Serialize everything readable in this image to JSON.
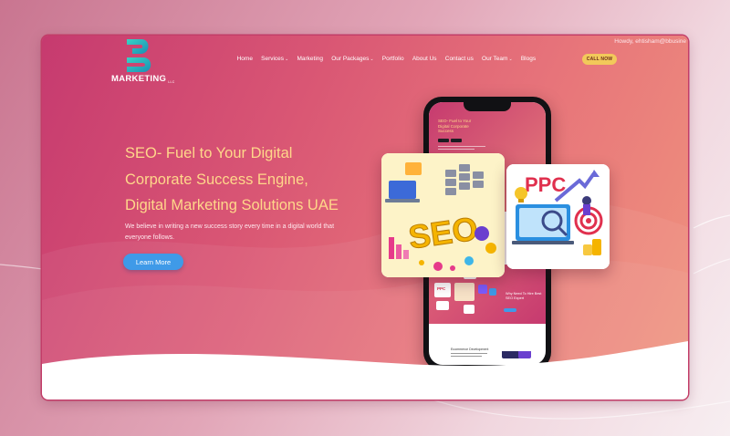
{
  "header": {
    "howdy": "Howdy, ehtisham@bbusine",
    "logo_text": "MARKETING",
    "logo_suffix": "LLC",
    "nav": [
      {
        "label": "Home",
        "dropdown": false
      },
      {
        "label": "Services",
        "dropdown": true
      },
      {
        "label": "Marketing",
        "dropdown": false
      },
      {
        "label": "Our Packages",
        "dropdown": true
      },
      {
        "label": "Portfolio",
        "dropdown": false
      },
      {
        "label": "About Us",
        "dropdown": false
      },
      {
        "label": "Contact us",
        "dropdown": false
      },
      {
        "label": "Our Team",
        "dropdown": true
      },
      {
        "label": "Blogs",
        "dropdown": false
      }
    ],
    "call_button": "CALL NOW"
  },
  "hero": {
    "title_lines": [
      "SEO- Fuel to Your Digital",
      "Corporate Success Engine,",
      "Digital Marketing Solutions UAE"
    ],
    "description_lines": [
      "We believe in writing a new success story every time in a digital world that",
      "everyone follows."
    ],
    "learn_more": "Learn More"
  },
  "phone": {
    "title_lines": [
      "SEO- Fuel to Your",
      "Digital Corporate",
      "Success"
    ],
    "why_lines": [
      "Why Need To Hire Best",
      "SEO Expert"
    ],
    "ecommerce": "Ecommerce Development"
  },
  "cards": {
    "seo_text": "SEO",
    "ppc_text": "PPC"
  },
  "colors": {
    "accent_yellow": "#ffd78a",
    "button_blue": "#3f9ae8",
    "call_yellow": "#f2c95a",
    "frame_pink": "#c63a6f"
  }
}
